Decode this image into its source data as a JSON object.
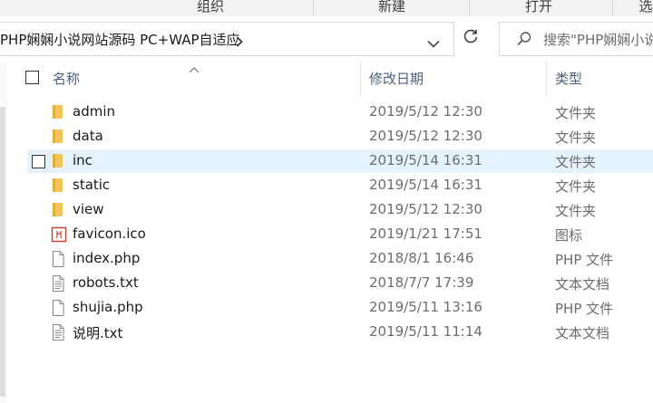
{
  "ribbon": {
    "groups": [
      "组织",
      "新建",
      "打开",
      "选"
    ]
  },
  "address_bar": {
    "path": "PHP娴娴小说网站源码 PC+WAP自适应"
  },
  "search": {
    "placeholder": "搜索\"PHP娴娴小说"
  },
  "columns": {
    "name": "名称",
    "date": "修改日期",
    "type": "类型"
  },
  "files": [
    {
      "name": "admin",
      "date": "2019/5/12 12:30",
      "type": "文件夹",
      "icon": "folder-icon"
    },
    {
      "name": "data",
      "date": "2019/5/12 12:30",
      "type": "文件夹",
      "icon": "folder-icon"
    },
    {
      "name": "inc",
      "date": "2019/5/14 16:31",
      "type": "文件夹",
      "icon": "folder-icon",
      "hovered": true
    },
    {
      "name": "static",
      "date": "2019/5/14 16:31",
      "type": "文件夹",
      "icon": "folder-icon"
    },
    {
      "name": "view",
      "date": "2019/5/12 12:30",
      "type": "文件夹",
      "icon": "folder-icon"
    },
    {
      "name": "favicon.ico",
      "date": "2019/1/21 17:51",
      "type": "图标",
      "icon": "ico-file-icon"
    },
    {
      "name": "index.php",
      "date": "2018/8/1 16:46",
      "type": "PHP 文件",
      "icon": "blank-file-icon"
    },
    {
      "name": "robots.txt",
      "date": "2018/7/7 17:39",
      "type": "文本文档",
      "icon": "text-file-icon"
    },
    {
      "name": "shujia.php",
      "date": "2019/5/11 13:16",
      "type": "PHP 文件",
      "icon": "blank-file-icon"
    },
    {
      "name": "说明.txt",
      "date": "2019/5/11 11:14",
      "type": "文本文档",
      "icon": "text-file-icon"
    }
  ],
  "colors": {
    "hover_row": "#e5f3ff",
    "folder": "#f2c55c",
    "header_text": "#4c607a",
    "secondary_text": "#6d6d6d"
  }
}
